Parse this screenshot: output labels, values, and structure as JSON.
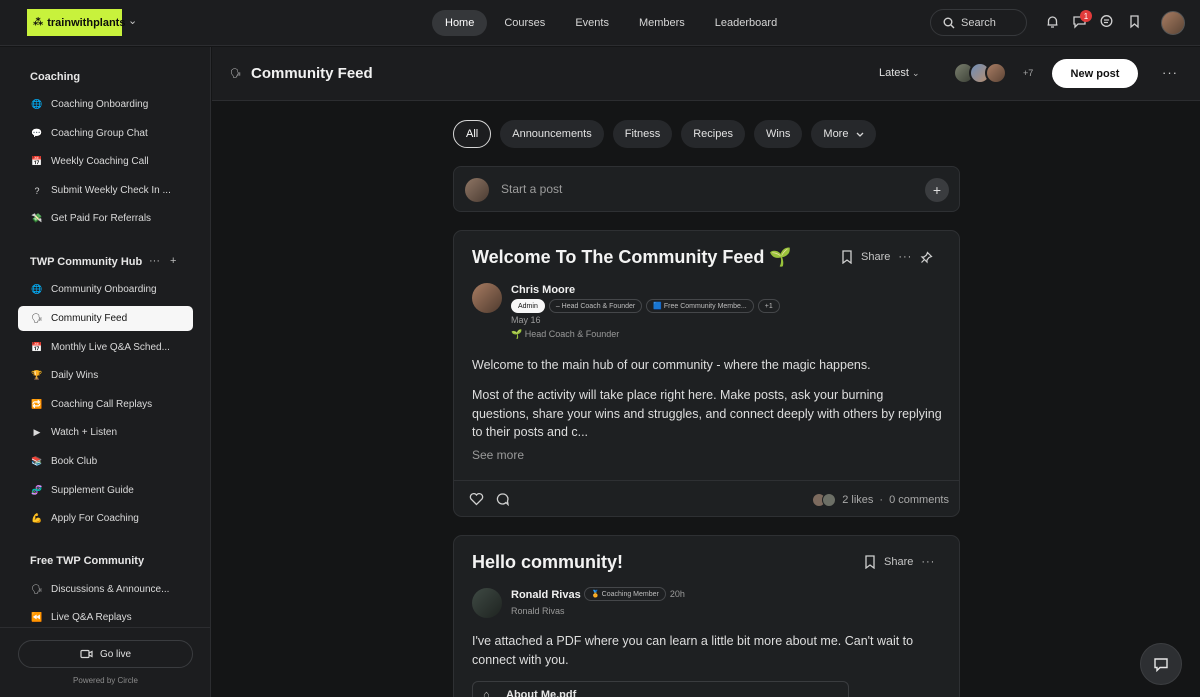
{
  "brand": {
    "logo_text": "trainwithplants",
    "accent": "#c8f23c"
  },
  "nav": {
    "items": [
      "Home",
      "Courses",
      "Events",
      "Members",
      "Leaderboard"
    ],
    "active": "Home"
  },
  "topbar": {
    "search_label": "Search",
    "notification_count": "1"
  },
  "sidebar": {
    "sections": [
      {
        "heading": "Coaching",
        "items": [
          {
            "emoji": "🌐",
            "label": "Coaching Onboarding"
          },
          {
            "emoji": "💬",
            "label": "Coaching Group Chat"
          },
          {
            "emoji": "📅",
            "label": "Weekly Coaching Call"
          },
          {
            "emoji": "?",
            "label": "Submit Weekly Check In ..."
          },
          {
            "emoji": "💸",
            "label": "Get Paid For Referrals"
          }
        ]
      },
      {
        "heading": "TWP Community Hub",
        "items": [
          {
            "emoji": "🌐",
            "label": "Community Onboarding"
          },
          {
            "emoji": "🗣",
            "label": "Community Feed"
          },
          {
            "emoji": "📅",
            "label": "Monthly Live Q&A Sched..."
          },
          {
            "emoji": "🏆",
            "label": "Daily Wins"
          },
          {
            "emoji": "🔁",
            "label": "Coaching Call Replays"
          },
          {
            "emoji": "▶",
            "label": "Watch + Listen"
          },
          {
            "emoji": "📚",
            "label": "Book Club"
          },
          {
            "emoji": "🧬",
            "label": "Supplement Guide"
          },
          {
            "emoji": "💪",
            "label": "Apply For Coaching"
          }
        ]
      },
      {
        "heading": "Free TWP Community",
        "items": [
          {
            "emoji": "🗣",
            "label": "Discussions & Announce..."
          },
          {
            "emoji": "⏪",
            "label": "Live Q&A Replays"
          }
        ]
      }
    ],
    "active_item": "Community Feed",
    "go_live_label": "Go live",
    "powered_by": "Powered by Circle"
  },
  "header": {
    "icon": "🗣",
    "title": "Community Feed",
    "sort_label": "Latest",
    "member_extra_count": "+7",
    "new_post_label": "New post"
  },
  "filters": {
    "chips": [
      "All",
      "Announcements",
      "Fitness",
      "Recipes",
      "Wins"
    ],
    "more_label": "More",
    "active": "All"
  },
  "composer": {
    "placeholder": "Start a post"
  },
  "posts": [
    {
      "title": "Welcome To The Community Feed 🌱",
      "share_label": "Share",
      "author": "Chris Moore",
      "tags": [
        "Admin",
        "– Head Coach & Founder",
        "🟦 Free Community Membe...",
        "+1"
      ],
      "date": "May 16",
      "headline": "🌱 Head Coach & Founder",
      "paragraphs": [
        "Welcome to the main hub of our community - where the magic happens.",
        "Most of the activity will take place right here. Make posts, ask your burning questions, share your wins and struggles, and connect deeply with others by replying to their posts and c..."
      ],
      "see_more": "See more",
      "likes": "2 likes",
      "separator": "·",
      "comments": "0 comments"
    },
    {
      "title": "Hello community!",
      "share_label": "Share",
      "author": "Ronald Rivas",
      "tag": "🏅 Coaching Member",
      "time": "20h",
      "headline": "Ronald Rivas",
      "paragraph": "I've attached a PDF where you can learn a little bit more about me. Can't wait to connect with you.",
      "attachment": "About Me.pdf"
    }
  ]
}
